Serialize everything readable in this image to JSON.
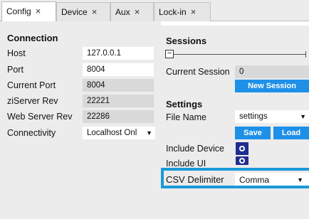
{
  "tabs": [
    {
      "label": "Config",
      "close": "×"
    },
    {
      "label": "Device",
      "close": "×"
    },
    {
      "label": "Aux",
      "close": "×"
    },
    {
      "label": "Lock-in",
      "close": "×"
    }
  ],
  "connection": {
    "title": "Connection",
    "host_label": "Host",
    "host_value": "127.0.0.1",
    "port_label": "Port",
    "port_value": "8004",
    "current_port_label": "Current Port",
    "current_port_value": "8004",
    "ziserver_rev_label": "ziServer Rev",
    "ziserver_rev_value": "22221",
    "web_server_rev_label": "Web Server Rev",
    "web_server_rev_value": "22286",
    "connectivity_label": "Connectivity",
    "connectivity_value": "Localhost Onl"
  },
  "sessions": {
    "title": "Sessions",
    "collapse_symbol": "−",
    "current_session_label": "Current Session",
    "current_session_value": "0",
    "new_session_label": "New Session"
  },
  "settings": {
    "title": "Settings",
    "file_name_label": "File Name",
    "file_name_value": "settings",
    "save_label": "Save",
    "load_label": "Load",
    "include_device_label": "Include Device",
    "include_ui_label": "Include UI",
    "csv_delimiter_label": "CSV Delimiter",
    "csv_delimiter_value": "Comma"
  },
  "colors": {
    "accent": "#1e90e8",
    "toggle": "#1f2d8f",
    "highlight": "#1b9ad9"
  }
}
